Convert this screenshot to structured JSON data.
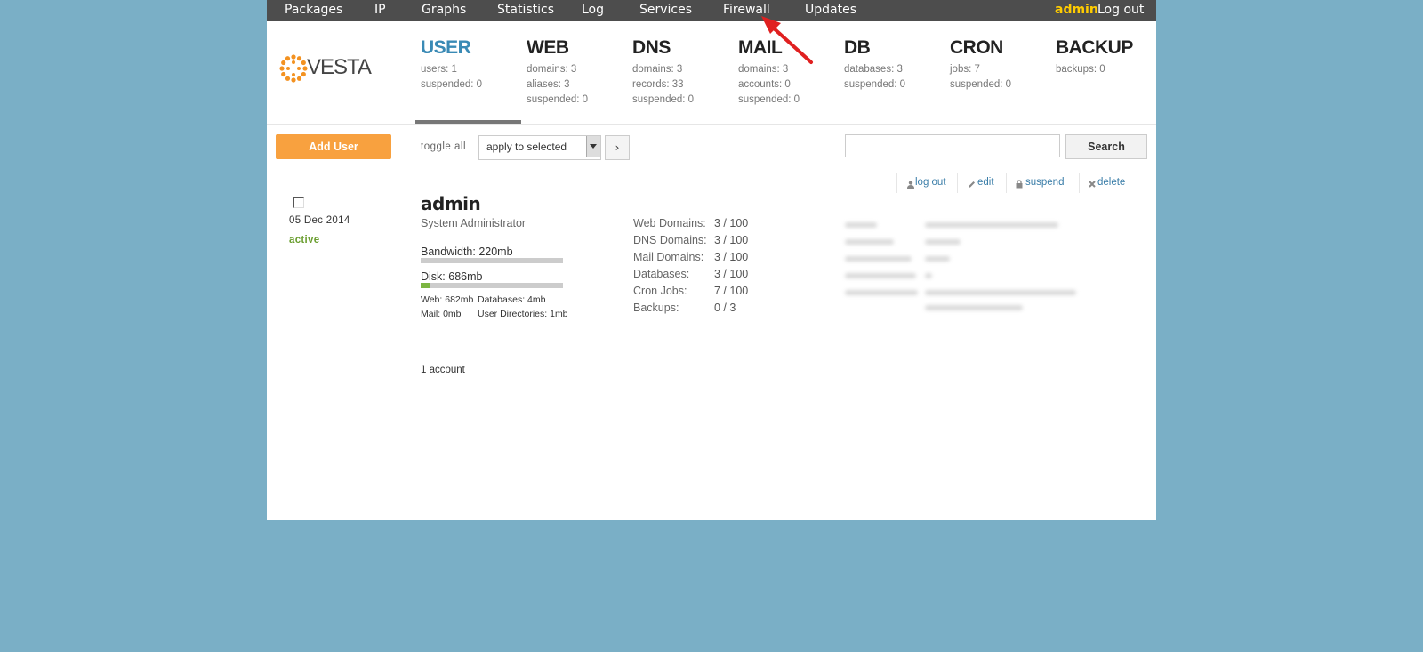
{
  "topnav": {
    "items": [
      "Packages",
      "IP",
      "Graphs",
      "Statistics",
      "Log",
      "Services",
      "Firewall",
      "Updates"
    ],
    "user": "admin",
    "logout": "Log out"
  },
  "logo": {
    "text": "VESTA"
  },
  "tabs": [
    {
      "title": "USER",
      "stats": [
        "users: 1",
        "suspended: 0"
      ]
    },
    {
      "title": "WEB",
      "stats": [
        "domains: 3",
        "aliases: 3",
        "suspended: 0"
      ]
    },
    {
      "title": "DNS",
      "stats": [
        "domains: 3",
        "records: 33",
        "suspended: 0"
      ]
    },
    {
      "title": "MAIL",
      "stats": [
        "domains: 3",
        "accounts: 0",
        "suspended: 0"
      ]
    },
    {
      "title": "DB",
      "stats": [
        "databases: 3",
        "suspended: 0"
      ]
    },
    {
      "title": "CRON",
      "stats": [
        "jobs: 7",
        "suspended: 0"
      ]
    },
    {
      "title": "BACKUP",
      "stats": [
        "backups: 0"
      ]
    }
  ],
  "toolbar": {
    "add_user": "Add User",
    "toggle_all": "toggle all",
    "apply_selected": "apply to selected",
    "apply_go": "›",
    "search_value": "",
    "search_button": "Search"
  },
  "row_actions": {
    "logout": "log out",
    "edit": "edit",
    "suspend": "suspend",
    "delete": "delete"
  },
  "user": {
    "date": "05 Dec 2014",
    "status": "active",
    "name": "admin",
    "role": "System Administrator",
    "bandwidth_label": "Bandwidth: 220mb",
    "bandwidth_fraction": 0.0,
    "disk_label": "Disk: 686mb",
    "disk_fraction": 0.07,
    "web_usage": "Web: 682mb",
    "db_usage": "Databases: 4mb",
    "mail_usage": "Mail: 0mb",
    "udir_usage": "User Directories: 1mb",
    "stats": [
      {
        "label": "Web Domains:",
        "value": "3 / 100"
      },
      {
        "label": "DNS Domains:",
        "value": "3 / 100"
      },
      {
        "label": "Mail Domains:",
        "value": "3 / 100"
      },
      {
        "label": "Databases:",
        "value": "3 / 100"
      },
      {
        "label": "Cron Jobs:",
        "value": "7 / 100"
      },
      {
        "label": "Backups:",
        "value": "0 / 3"
      }
    ]
  },
  "footer_count": "1 account",
  "colors": {
    "background": "#7aafc6",
    "accent": "#f8a13f",
    "active_tab": "#3a8ab5",
    "status_active": "#6a9e2f",
    "disk_fill": "#7cb542"
  },
  "annotation": {
    "icon": "red-arrow-icon",
    "color": "#e02020"
  }
}
